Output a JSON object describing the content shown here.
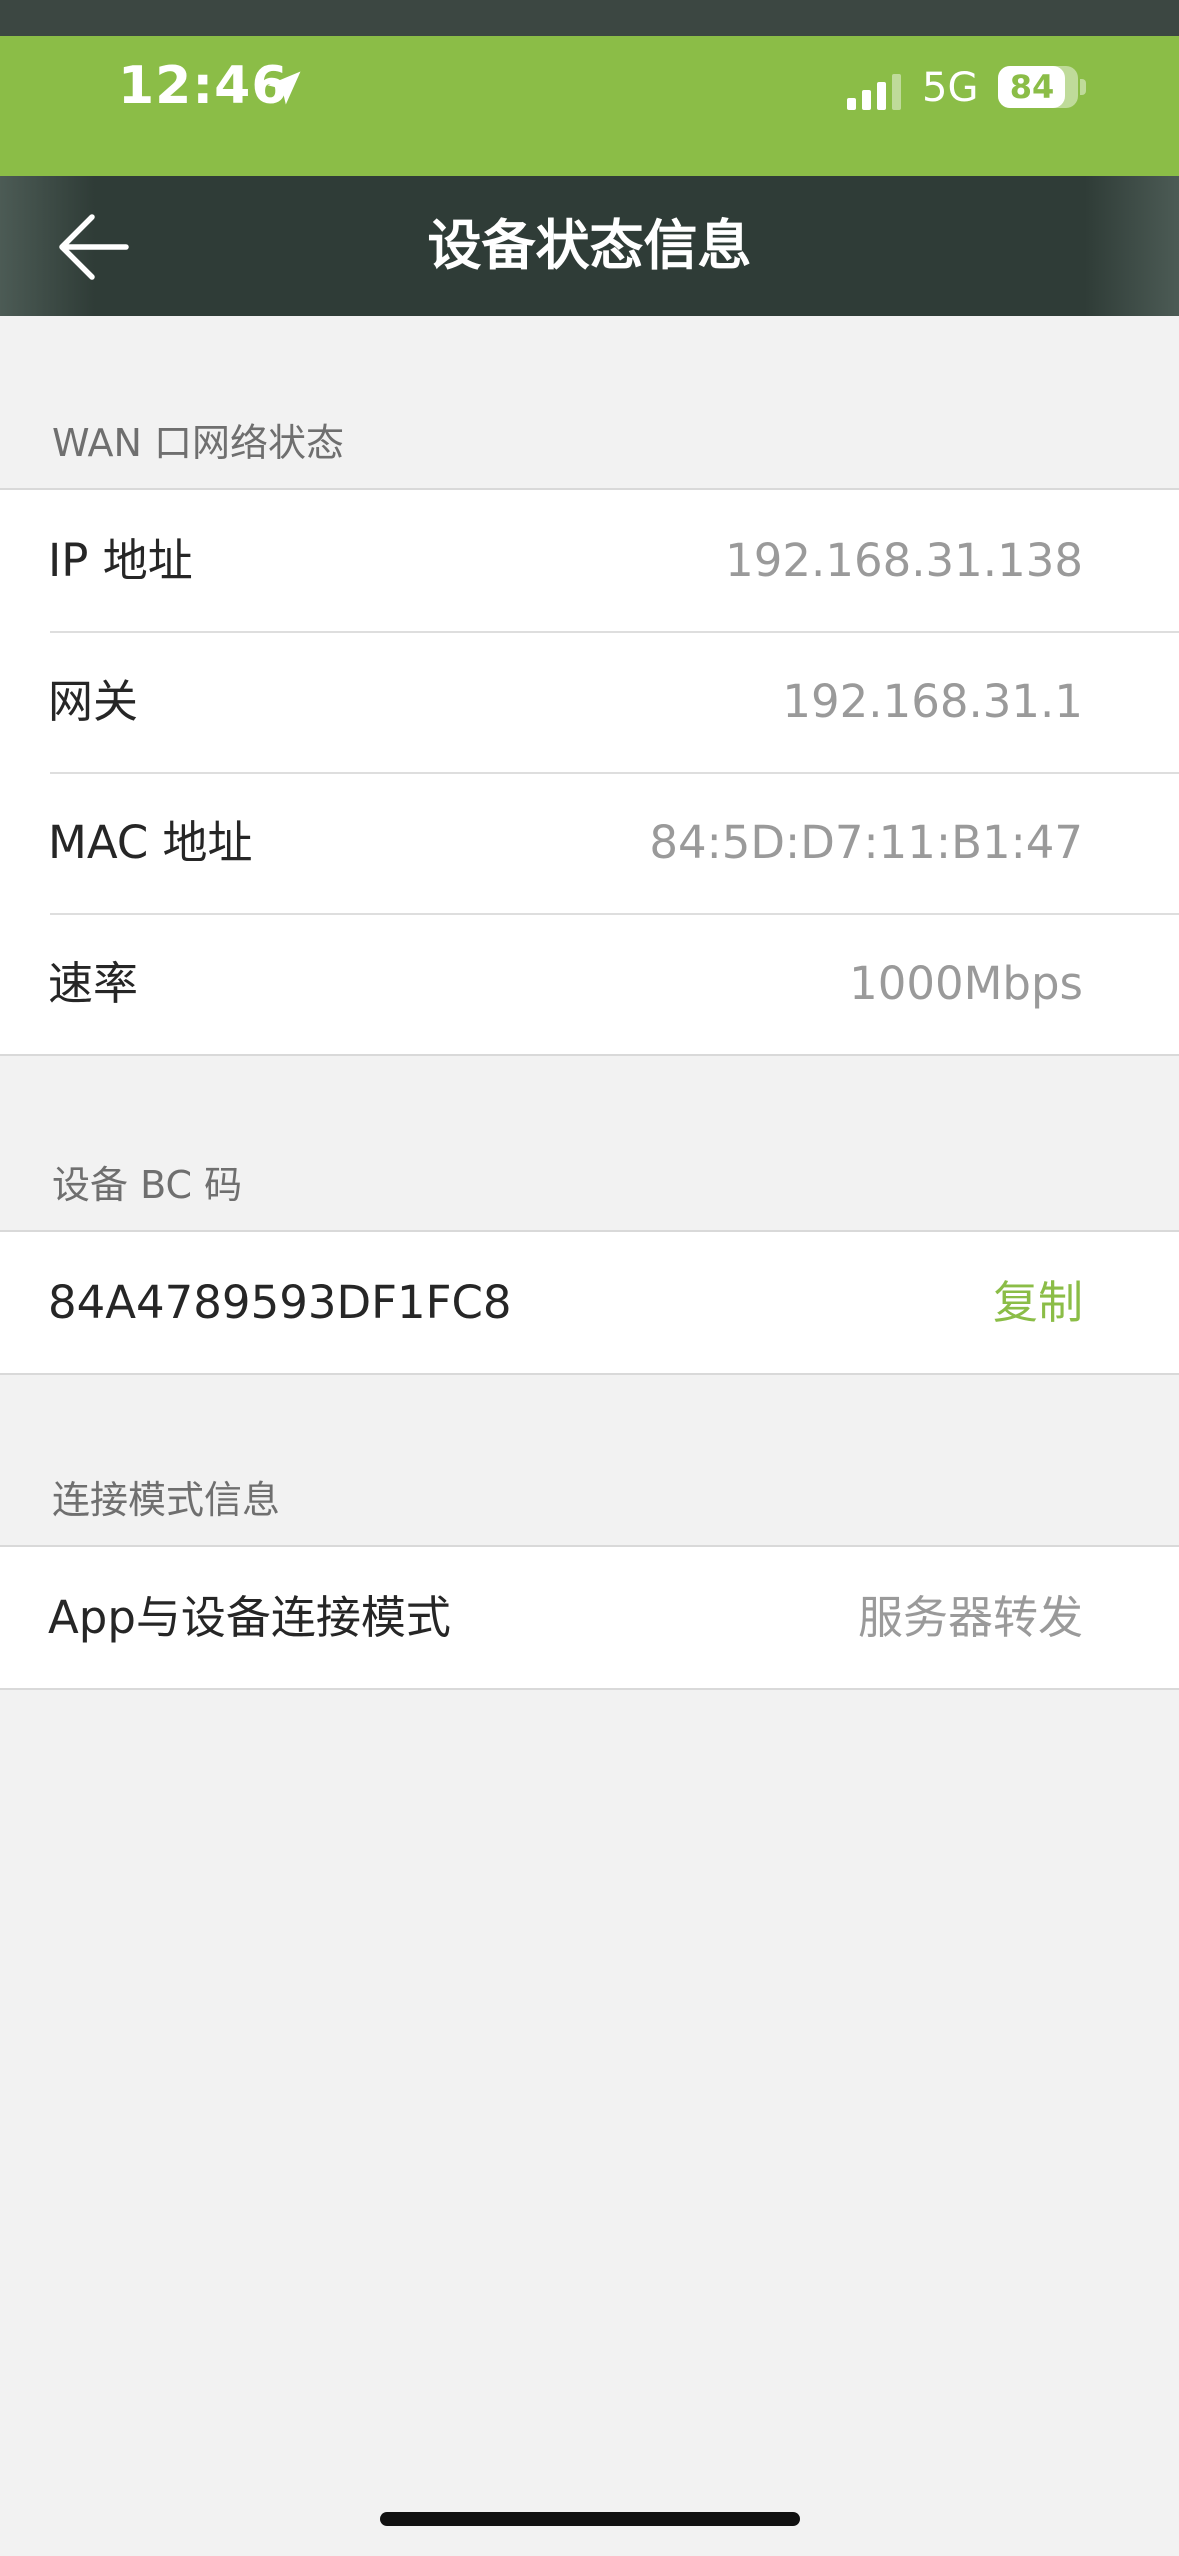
{
  "status_bar": {
    "time": "12:46",
    "network": "5G",
    "battery_percent": "84",
    "battery_level": 0.84,
    "icons": [
      "location-arrow-icon",
      "signal-icon",
      "battery-icon"
    ]
  },
  "nav": {
    "title": "设备状态信息",
    "back_icon": "arrow-left-icon"
  },
  "wan": {
    "header": "WAN 口网络状态",
    "ip": {
      "label": "IP 地址",
      "value": "192.168.31.138"
    },
    "gateway": {
      "label": "网关",
      "value": "192.168.31.1"
    },
    "mac": {
      "label": "MAC 地址",
      "value": "84:5D:D7:11:B1:47"
    },
    "speed": {
      "label": "速率",
      "value": "1000Mbps"
    }
  },
  "bc": {
    "header": "设备 BC 码",
    "code": "84A4789593DF1FC8",
    "copy_label": "复制"
  },
  "connection": {
    "header": "连接模式信息",
    "mode": {
      "label": "App与设备连接模式",
      "value": "服务器转发"
    }
  },
  "colors": {
    "brand": "#8bbd47",
    "nav_background": "#2f3c37",
    "page_background": "#f2f2f2"
  }
}
